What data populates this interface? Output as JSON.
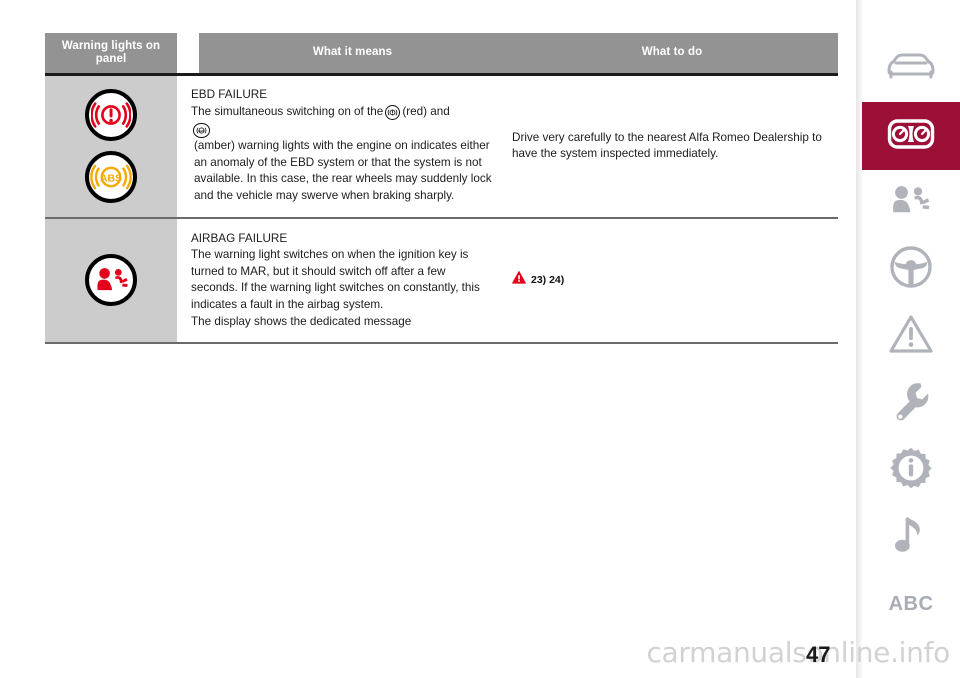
{
  "table": {
    "headers": {
      "icons": "Warning lights on panel",
      "meaning": "What it means",
      "action": "What to do"
    },
    "rows": [
      {
        "id": "ebd-failure",
        "lamps": [
          "brake-warning-lamp-red",
          "abs-warning-lamp-amber"
        ],
        "title": "EBD FAILURE",
        "text_part1": "The simultaneous switching on of the",
        "inline_icon_1": "brake-warning-icon",
        "text_part2": "(red) and",
        "inline_icon_2": "abs-warning-icon",
        "text_part3": "(amber) warning lights with the engine on indicates either an anomaly of the EBD system or that the system is not available. In this case, the rear wheels may suddenly lock and the vehicle may swerve when braking sharply.",
        "action": "Drive very carefully to the nearest Alfa Romeo Dealership to have the system inspected immediately.",
        "action_refs": ""
      },
      {
        "id": "airbag-failure",
        "lamps": [
          "airbag-warning-lamp-red"
        ],
        "title": "AIRBAG FAILURE",
        "text_part1": "The warning light switches on when the ignition key is turned to MAR, but it should switch off after a few seconds. If the warning light switches on constantly, this indicates a fault in the airbag system.",
        "text_part2": "The display shows the dedicated message",
        "action": "",
        "action_refs": "23) 24)"
      }
    ]
  },
  "sidebar": {
    "items": [
      {
        "icon": "car-front-icon",
        "label": "",
        "active": false
      },
      {
        "icon": "dashboard-icon",
        "label": "",
        "active": true
      },
      {
        "icon": "airbag-safety-icon",
        "label": "",
        "active": false
      },
      {
        "icon": "steering-wheel-icon",
        "label": "",
        "active": false
      },
      {
        "icon": "warning-triangle-icon",
        "label": "",
        "active": false
      },
      {
        "icon": "wrench-icon",
        "label": "",
        "active": false
      },
      {
        "icon": "gear-info-icon",
        "label": "",
        "active": false
      },
      {
        "icon": "music-note-icon",
        "label": "",
        "active": false
      },
      {
        "icon": "abc-index-icon",
        "label": "ABC",
        "active": false
      }
    ],
    "active_color": "#9c0f36",
    "icon_color": "#b0b4ba"
  },
  "footer": {
    "page_number": "47",
    "watermark": "carmanualsonline.info"
  },
  "colors": {
    "header_gray": "#939393",
    "icon_cell_gray": "#cccccc",
    "warning_red": "#e2001a",
    "warning_amber": "#f5a800",
    "accent_dark_red": "#9c0f36"
  }
}
